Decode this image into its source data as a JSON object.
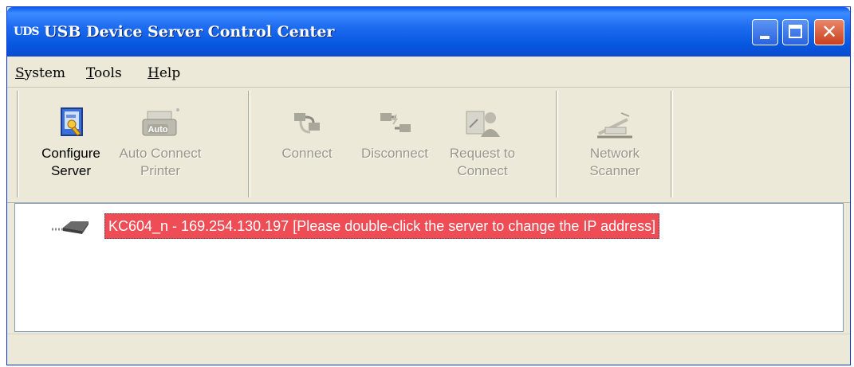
{
  "window": {
    "title": "USB Device Server Control Center",
    "app_icon": "UDS",
    "controls": [
      "minimize-icon",
      "maximize-icon",
      "close-icon"
    ],
    "close_glyph": "✕"
  },
  "menu": {
    "items": [
      "System",
      "Tools",
      "Help"
    ]
  },
  "toolbar": {
    "buttons": [
      {
        "label": "Configure\nServer",
        "icon": "configure-server-icon",
        "enabled": true
      },
      {
        "label": "Auto Connect\nPrinter",
        "icon": "auto-connect-printer-icon",
        "enabled": false,
        "icon_text": "Auto"
      },
      {
        "label": "Connect",
        "icon": "connect-icon",
        "enabled": false
      },
      {
        "label": "Disconnect",
        "icon": "disconnect-icon",
        "enabled": false
      },
      {
        "label": "Request to\nConnect",
        "icon": "request-to-connect-icon",
        "enabled": false
      },
      {
        "label": "Network\nScanner",
        "icon": "network-scanner-icon",
        "enabled": false
      }
    ]
  },
  "server_list": {
    "items": [
      {
        "text": "KC604_n - 169.254.130.197 [Please double-click the server to change the IP address]",
        "icon": "server-device-icon",
        "selected": true,
        "highlight_color": "#ee4d55"
      }
    ]
  },
  "colors": {
    "titlebar": "#0757e0",
    "window_bg": "#ece9d8",
    "selection": "#ee4d55"
  }
}
